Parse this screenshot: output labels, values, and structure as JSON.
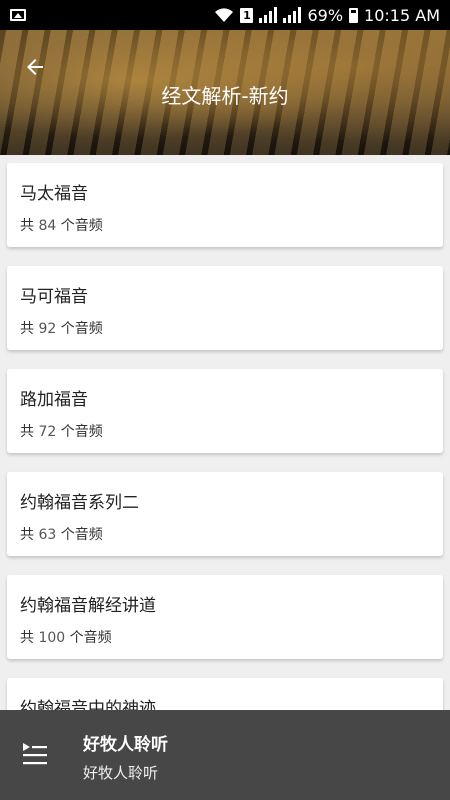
{
  "status_bar": {
    "battery": "69%",
    "time": "10:15 AM",
    "sim": "1"
  },
  "header": {
    "title": "经文解析-新约",
    "back_icon": "arrow-left-icon"
  },
  "list": {
    "items": [
      {
        "title": "马太福音",
        "prefix": "共",
        "count": "84",
        "suffix": "个音频"
      },
      {
        "title": "马可福音",
        "prefix": "共",
        "count": "92",
        "suffix": "个音频"
      },
      {
        "title": "路加福音",
        "prefix": "共",
        "count": "72",
        "suffix": "个音频"
      },
      {
        "title": "约翰福音系列二",
        "prefix": "共",
        "count": "63",
        "suffix": "个音频"
      },
      {
        "title": "约翰福音解经讲道",
        "prefix": "共",
        "count": "100",
        "suffix": "个音频"
      },
      {
        "title": "约翰福音中的神迹",
        "prefix": "",
        "count": "",
        "suffix": ""
      }
    ]
  },
  "player": {
    "title": "好牧人聆听",
    "subtitle": "好牧人聆听",
    "icon": "playlist-play-icon"
  }
}
